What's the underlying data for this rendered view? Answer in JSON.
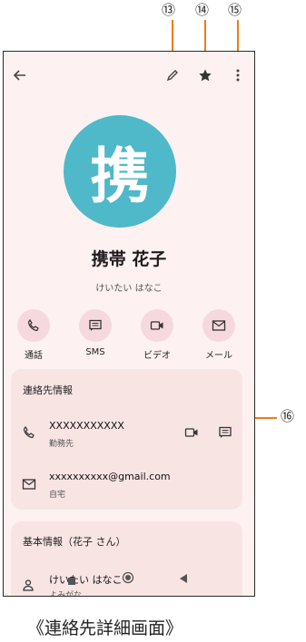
{
  "callouts": {
    "c13": "⑬",
    "c14": "⑭",
    "c15": "⑮",
    "c16": "⑯"
  },
  "toolbar": {
    "back_icon": "arrow-left",
    "edit_icon": "pencil",
    "favorite_icon": "star",
    "more_icon": "more-vertical"
  },
  "contact": {
    "avatar_char": "携",
    "avatar_color": "#4fb8c9",
    "name": "携帯 花子",
    "reading": "けいたい はなこ"
  },
  "actions": [
    {
      "label": "通話",
      "icon": "phone"
    },
    {
      "label": "SMS",
      "icon": "message"
    },
    {
      "label": "ビデオ",
      "icon": "video"
    },
    {
      "label": "メール",
      "icon": "mail"
    }
  ],
  "contact_info": {
    "title": "連絡先情報",
    "phone": {
      "value": "XXXXXXXXXXX",
      "type": "勤務先"
    },
    "email": {
      "value": "xxxxxxxxxx@gmail.com",
      "type": "自宅"
    }
  },
  "basic_info": {
    "title": "基本情報（花子 さん）",
    "reading_value": "けいたい はなこ",
    "reading_label": "よみがな"
  },
  "caption": "《連絡先詳細画面》",
  "colors": {
    "accent_orange": "#f07b1a",
    "screen_bg": "#fdf1f1",
    "card_bg": "#f9e4e4",
    "action_bg": "#f6d9de"
  }
}
